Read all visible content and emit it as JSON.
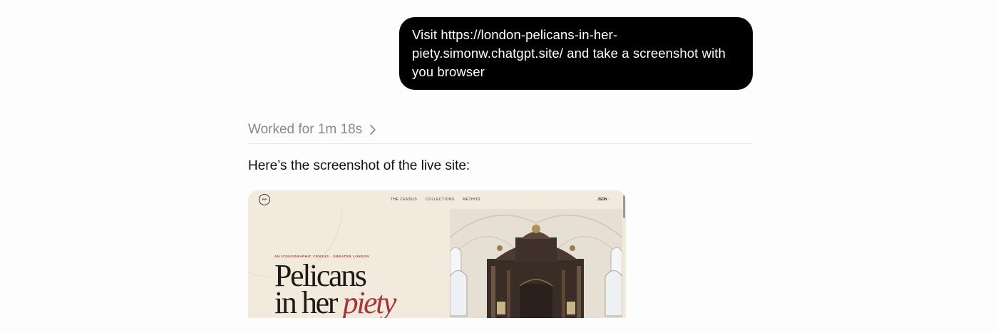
{
  "user_message": {
    "lines": [
      "Visit https://london-pelicans-in-her-",
      "piety.simonw.chatgpt.site/ and take a screenshot with",
      "you browser"
    ]
  },
  "status": {
    "worked_label": "Worked for 1m 18s",
    "chevron_icon": "chevron-right-icon"
  },
  "reply": {
    "text": "Here’s the screenshot of the live site:"
  },
  "screenshot": {
    "logo": "P/P",
    "nav": [
      "THE CENSUS",
      "COLLECTIONS",
      "METHOD"
    ],
    "json_link": "JSON ↓",
    "eyebrow": "AN ICONOGRAPHIC CENSUS · GREATER LONDON",
    "hero_line1": "Pelicans",
    "hero_line2_plain": "in her",
    "hero_line2_accent": "piety",
    "accent_color": "#a73637",
    "photo_subject": "church interior with carved dark wood reredos"
  }
}
